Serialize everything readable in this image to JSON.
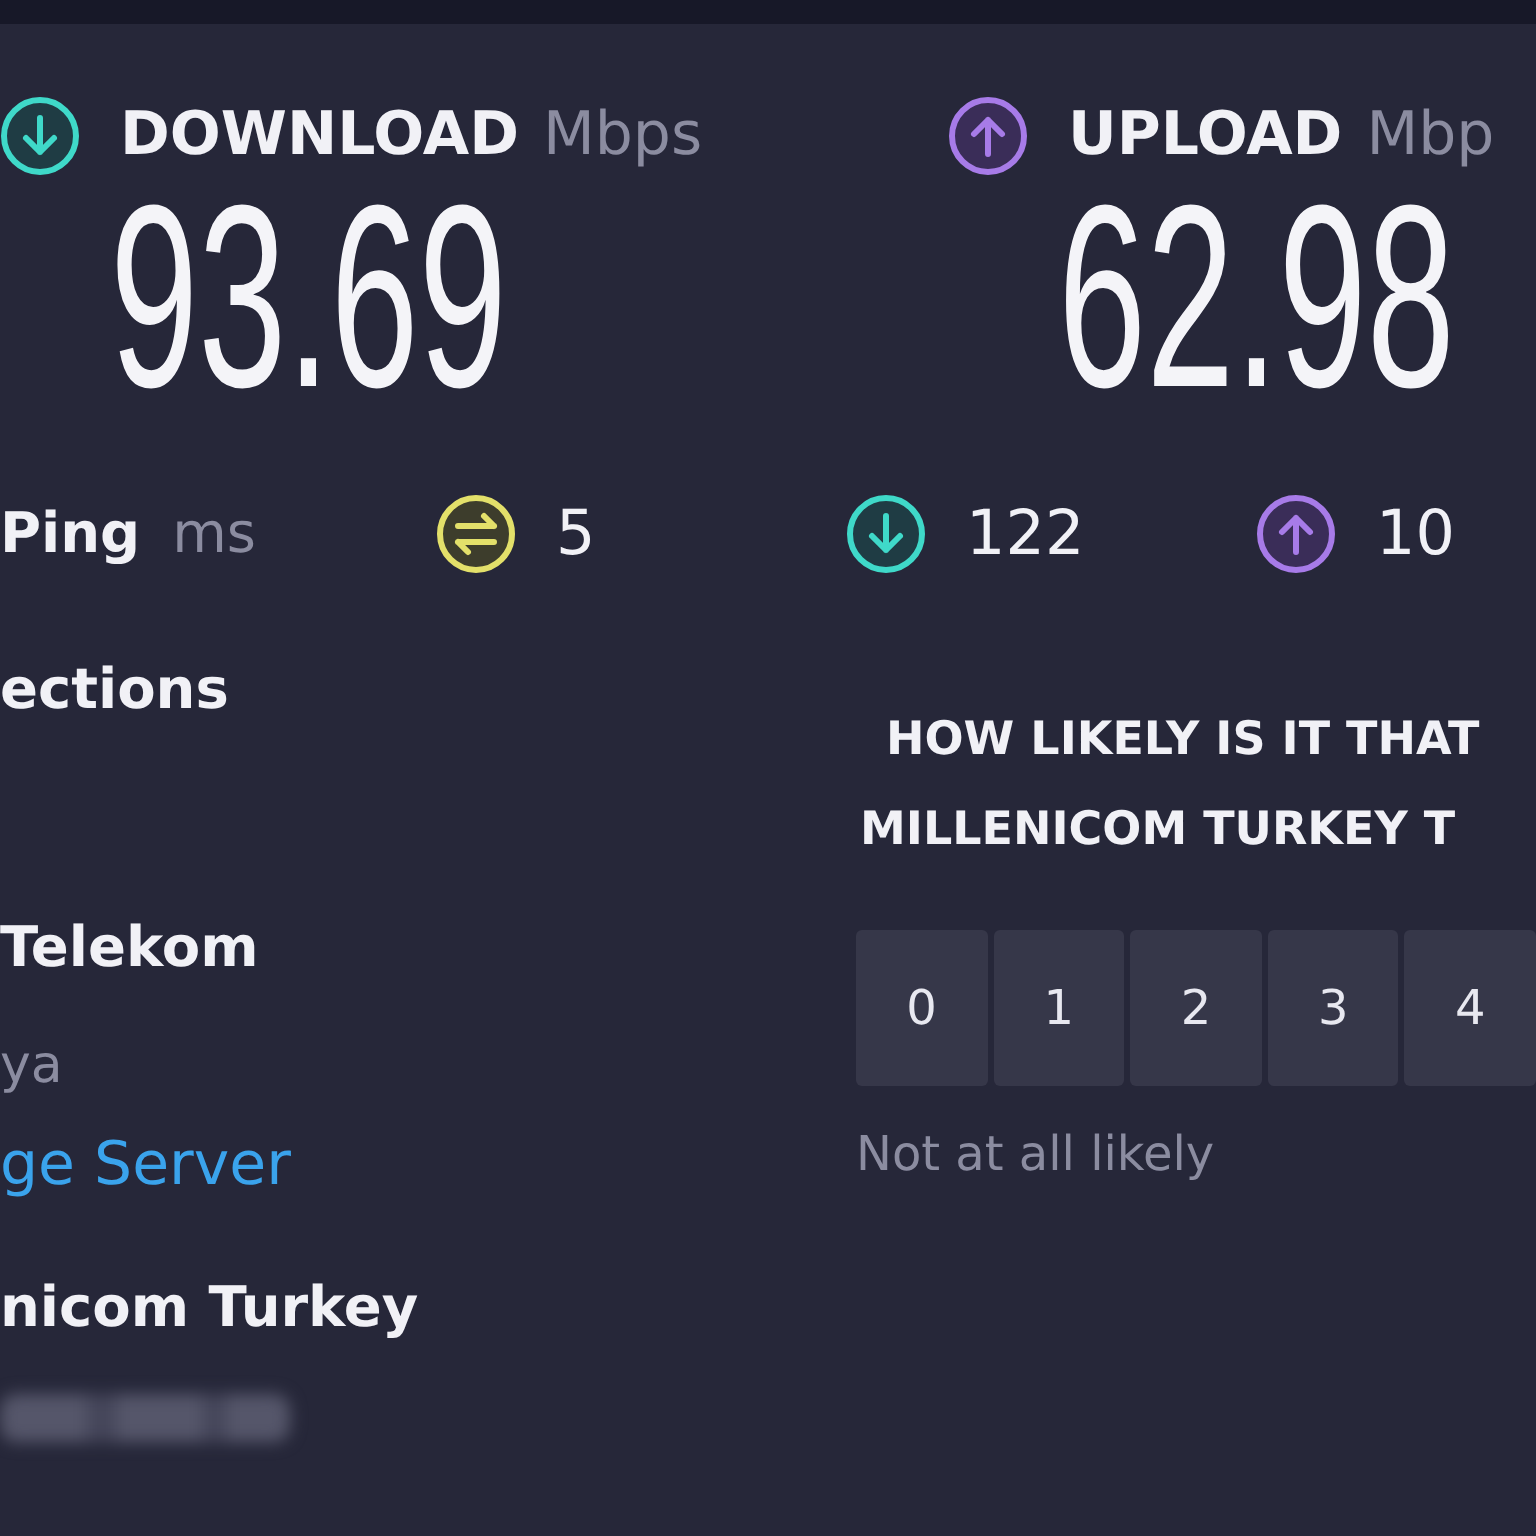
{
  "results": [
    {
      "kind": "download",
      "label": "DOWNLOAD",
      "unit": "Mbps",
      "value": "93.69"
    },
    {
      "kind": "upload",
      "label": "UPLOAD",
      "unit": "Mbp",
      "value": "62.98"
    }
  ],
  "ping": {
    "label": "Ping",
    "unit": "ms",
    "readings": [
      {
        "kind": "jitter",
        "value": "5"
      },
      {
        "kind": "download",
        "value": "122"
      },
      {
        "kind": "upload",
        "value": "10"
      }
    ]
  },
  "connections": {
    "heading": "ections",
    "isp": "Telekom",
    "location": "ya",
    "link": "ge Server",
    "server": "nicom Turkey",
    "blurred_address": true
  },
  "survey": {
    "question_lines": [
      "HOW LIKELY IS IT THAT",
      "MILLENICOM TURKEY T"
    ],
    "options": [
      {
        "label": "0",
        "selected": false
      },
      {
        "label": "1",
        "selected": false
      },
      {
        "label": "2",
        "selected": false
      },
      {
        "label": "3",
        "selected": false
      },
      {
        "label": "4",
        "selected": false
      }
    ],
    "low_label": "Not at all likely"
  }
}
